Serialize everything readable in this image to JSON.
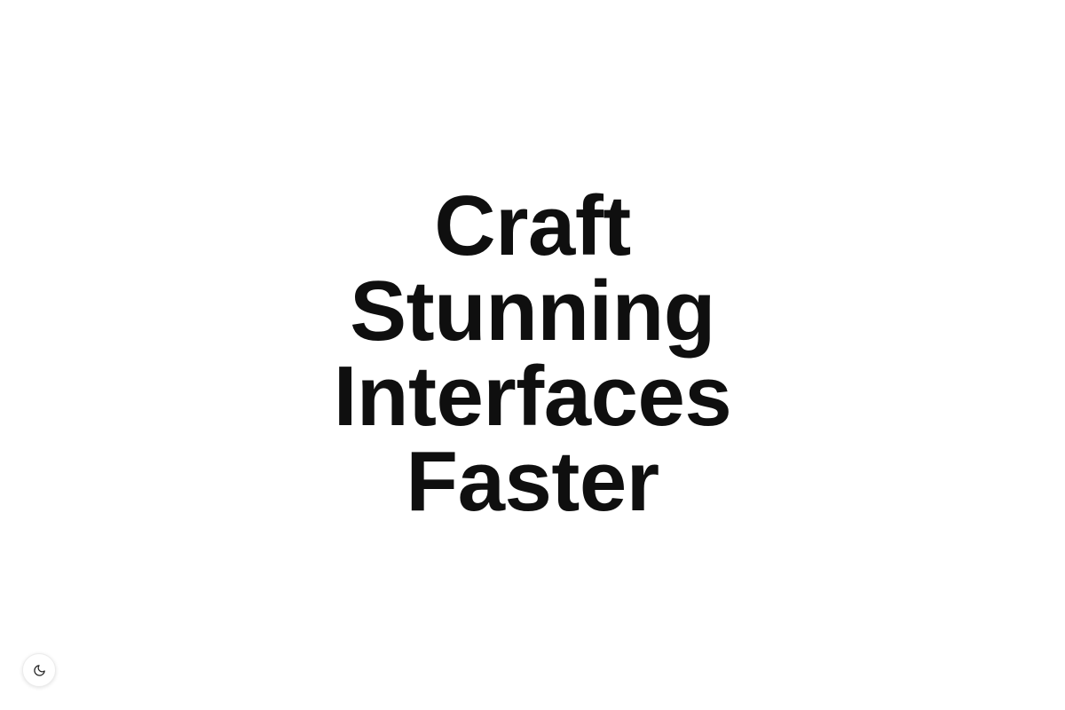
{
  "hero": {
    "lines": [
      "Craft",
      "Stunning",
      "Interfaces",
      "Faster"
    ]
  },
  "theme_toggle": {
    "icon": "moon-icon"
  },
  "colors": {
    "background": "#ffffff",
    "text": "#0f0f0f"
  }
}
